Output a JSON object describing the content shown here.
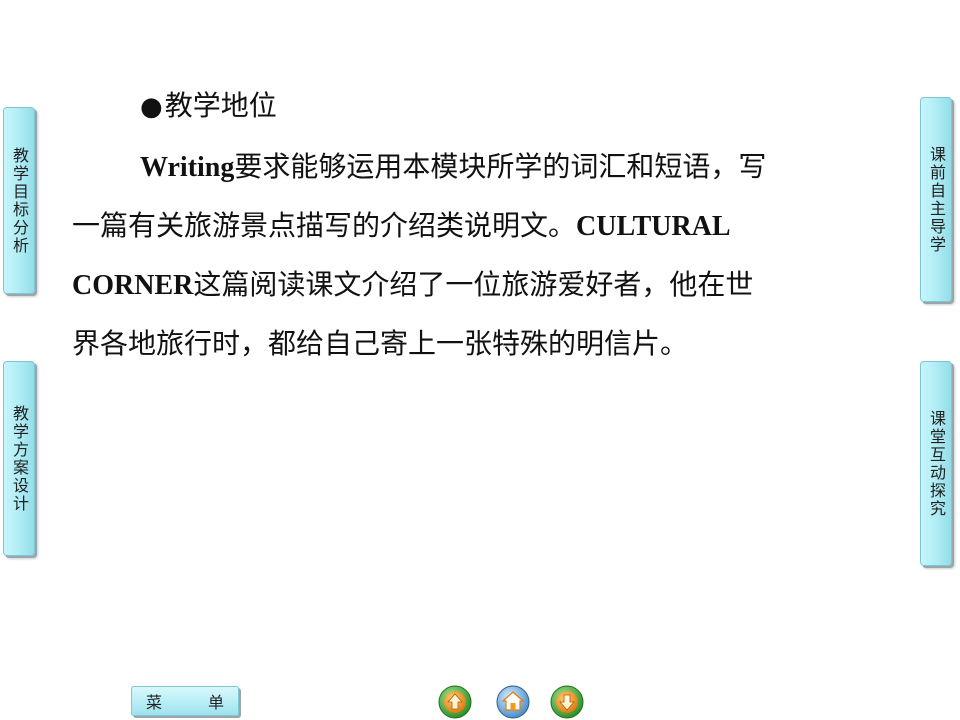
{
  "side_tabs": {
    "top_left": "教学目标分析",
    "bottom_left": "教学方案设计",
    "top_right": "课前自主导学",
    "bottom_right": "课堂互动探究"
  },
  "heading": {
    "bullet": "●",
    "text": "教学地位"
  },
  "paragraph": {
    "line1_bold": "Writing",
    "line1_rest": "要求能够运用本模块所学的词汇和短语，写",
    "line2_rest": "一篇有关旅游景点描写的介绍类说明文。",
    "line2_bold": "CULTURAL",
    "line3_bold": "CORNER",
    "line3_rest": "这篇阅读课文介绍了一位旅游爱好者，他在世",
    "line4_rest": "界各地旅行时，都给自己寄上一张特殊的明信片。"
  },
  "bottom_nav": {
    "menu_char1": "菜",
    "menu_char2": "单",
    "icons": [
      "arrow-up-icon",
      "home-icon",
      "arrow-down-icon"
    ]
  },
  "colors": {
    "tab_fill": "#b3eef6",
    "tab_border": "#7ec6d3",
    "nav_orange": "#f29a1f",
    "nav_green": "#3fa835"
  }
}
